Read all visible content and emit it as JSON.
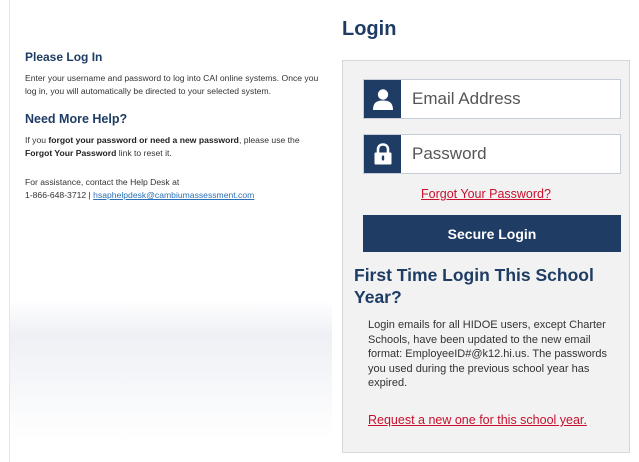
{
  "help": {
    "heading1": "Please Log In",
    "text1": "Enter your username and password to log into CAI online systems. Once you log in, you will automatically be directed to your selected system.",
    "heading2": "Need More Help?",
    "text2_prefix": "If you ",
    "text2_bold1": "forgot your password or need a new password",
    "text2_mid": ", please use the ",
    "text2_bold2": "Forgot Your Password",
    "text2_suffix": " link to reset it.",
    "assist_line1": "For assistance, contact the Help Desk at",
    "assist_phone": "1-866-648-3712 | ",
    "assist_email": "hsaphelpdesk@cambiumassessment.com"
  },
  "login": {
    "title": "Login",
    "email_placeholder": "Email Address",
    "email_value": "",
    "password_placeholder": "Password",
    "password_value": "",
    "forgot_link": "Forgot Your Password?",
    "submit_label": "Secure Login"
  },
  "first_time": {
    "heading": "First Time Login This School Year?",
    "body": "Login emails for all HIDOE users, except Charter Schools, have been updated to the new email format: EmployeeID#@k12.hi.us. The passwords you used during the previous school year has expired.",
    "request_link": "Request a new one for this school year."
  },
  "icons": {
    "email": "user-icon",
    "password": "lock-icon"
  },
  "colors": {
    "brand_navy": "#1e3c64",
    "link_red": "#c8102e",
    "link_blue": "#2a6fb7",
    "panel_bg": "#f2f2f2"
  }
}
